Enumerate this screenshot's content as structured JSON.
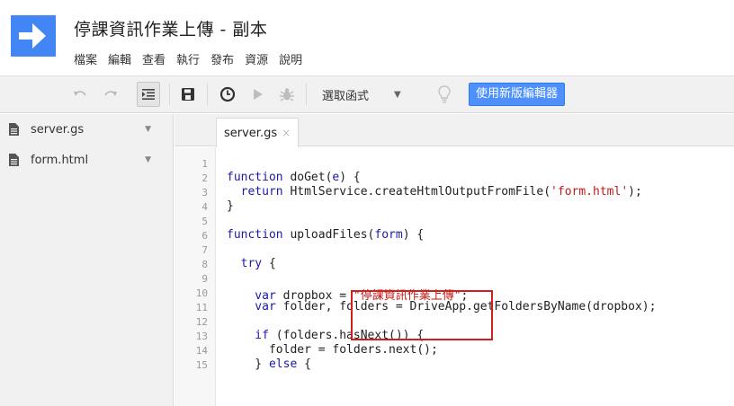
{
  "header": {
    "title": "停課資訊作業上傳 - 副本",
    "menu": [
      "檔案",
      "編輯",
      "查看",
      "執行",
      "發布",
      "資源",
      "說明"
    ]
  },
  "toolbar": {
    "function_select": "選取函式",
    "new_editor_button": "使用新版編輯器",
    "icons": [
      "undo-icon",
      "redo-icon",
      "indent-icon",
      "save-icon",
      "trigger-clock-icon",
      "run-icon",
      "debug-icon",
      "lightbulb-icon"
    ]
  },
  "sidebar": {
    "files": [
      {
        "name": "server.gs"
      },
      {
        "name": "form.html"
      }
    ]
  },
  "tabs": [
    {
      "label": "server.gs",
      "close": "×"
    }
  ],
  "editor": {
    "line_numbers": [
      "1",
      "2",
      "3",
      "4",
      "5",
      "6",
      "7",
      "8",
      "9",
      "10",
      "11",
      "12",
      "13",
      "14",
      "15"
    ],
    "lines": {
      "l2": {
        "kw": "function",
        "name": " doGet(",
        "param": "e",
        "rest": ") {"
      },
      "l3": {
        "kw": "  return",
        "rest": " HtmlService.createHtmlOutputFromFile(",
        "str": "'form.html'",
        "end": ");"
      },
      "l4": {
        "text": "}"
      },
      "l6": {
        "kw": "function",
        "name": " uploadFiles(",
        "param": "form",
        "rest": ") {"
      },
      "l8": {
        "kw": "  try",
        "rest": " {"
      },
      "l10": {
        "kw": "    var",
        "rest": " dropbox = ",
        "str": "\"停課資訊作業上傳\"",
        "end": ";"
      },
      "l11": {
        "kw": "    var",
        "rest": " folder, folders = DriveApp.getFoldersByName(dropbox);"
      },
      "l13": {
        "kw": "    if",
        "rest": " (folders.hasNext()) {"
      },
      "l14": {
        "text": "      folder = folders.next();"
      },
      "l15": {
        "pre": "    } ",
        "kw": "else",
        "rest": " {"
      }
    }
  },
  "colors": {
    "accent": "#4d90fe",
    "highlight_box": "#d0201e",
    "keyword": "#1a1aa6",
    "string": "#c41a16"
  }
}
